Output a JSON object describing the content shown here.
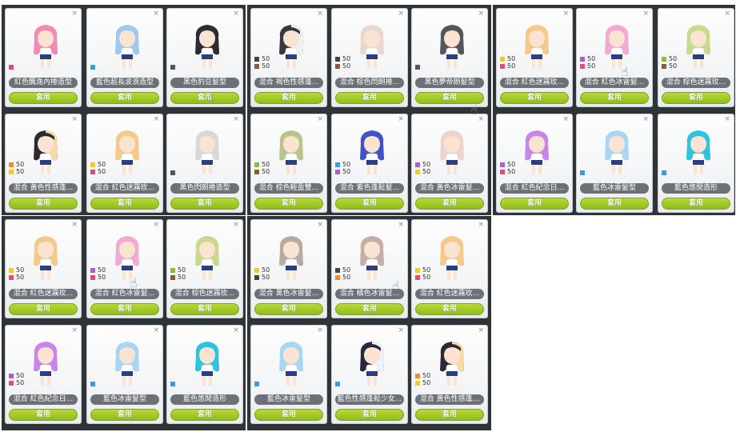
{
  "apply_label": "套用",
  "close_glyph": "×",
  "hand_glyph": "☝",
  "cards": [
    {
      "name": "紅色飄逸內捲造型",
      "hair": "#f28ab8",
      "legend": [
        {
          "color": "#e04b7a"
        }
      ]
    },
    {
      "name": "藍色超長波浪造型",
      "hair": "#9ec8ef",
      "legend": [
        {
          "color": "#3a9be0"
        }
      ]
    },
    {
      "name": "黑色豹豆髮型",
      "hair": "#2e2a36",
      "legend": [
        {
          "color": "#555555"
        }
      ]
    },
    {
      "name": "混合 褐色性感蓬...",
      "hair": "#3a3540",
      "hair2": "#f0f0f0",
      "legend": [
        {
          "color": "#444444",
          "pct": "50"
        },
        {
          "color": "#8b5a3c",
          "pct": "50"
        }
      ]
    },
    {
      "name": "混合 棕色閃朗捲...",
      "hair": "#e9d8cf",
      "legend": [
        {
          "color": "#444444",
          "pct": "50"
        },
        {
          "color": "#8b5a3c",
          "pct": "50"
        }
      ]
    },
    {
      "name": "黑色夢帝朗髮型",
      "hair": "#55555c",
      "legend": [
        {
          "color": "#555555"
        }
      ]
    },
    {
      "name": "混合 紅色迷霧玫...",
      "hair": "#f5c98a",
      "legend": [
        {
          "color": "#f2cc1e",
          "pct": "50"
        },
        {
          "color": "#e04b7a",
          "pct": "50"
        }
      ]
    },
    {
      "name": "混合 紅色冰雷髮...",
      "hair": "#f4a9d4",
      "legend": [
        {
          "color": "#a65fd6",
          "pct": "50"
        },
        {
          "color": "#e04b7a",
          "pct": "50"
        }
      ]
    },
    {
      "name": "混合 棕色迷霧玫...",
      "hair": "#c7d98a",
      "legend": [
        {
          "color": "#8cbf2e",
          "pct": "50"
        },
        {
          "color": "#8b5a3c",
          "pct": "50"
        }
      ]
    },
    {
      "name": "混合 黃色性感蓬...",
      "hair": "#2a2a30",
      "hair2": "#f7d9a8",
      "legend": [
        {
          "color": "#f08a2e",
          "pct": "50"
        },
        {
          "color": "#f2cc1e",
          "pct": "50"
        }
      ]
    },
    {
      "name": "混合 紅色迷霧玫...",
      "hair": "#f5c98a",
      "legend": [
        {
          "color": "#f2cc1e",
          "pct": "50"
        },
        {
          "color": "#e04b7a",
          "pct": "50"
        }
      ]
    },
    {
      "name": "黑色閃朗捲造型",
      "hair": "#d8d8dc",
      "legend": [
        {
          "color": "#555555"
        }
      ]
    },
    {
      "name": "混合 棕色輕盈雙...",
      "hair": "#b9c48a",
      "legend": [
        {
          "color": "#8cbf2e",
          "pct": "50"
        },
        {
          "color": "#8b5a3c",
          "pct": "50"
        }
      ]
    },
    {
      "name": "混合 紫色蓬鬆髮...",
      "hair": "#3f52c8",
      "legend": [
        {
          "color": "#3a9be0",
          "pct": "50"
        },
        {
          "color": "#a65fd6",
          "pct": "50"
        }
      ]
    },
    {
      "name": "混合 黃色冰雷髮...",
      "hair": "#eed3cc",
      "legend": [
        {
          "color": "#a65fd6",
          "pct": "50"
        },
        {
          "color": "#f2cc1e",
          "pct": "50"
        }
      ]
    },
    {
      "name": "混合 紅色紀念日...",
      "hair": "#c886e8",
      "legend": [
        {
          "color": "#a65fd6",
          "pct": "50"
        },
        {
          "color": "#e04b7a",
          "pct": "50"
        }
      ]
    },
    {
      "name": "藍色冰雷髮型",
      "hair": "#a6d6f4",
      "legend": [
        {
          "color": "#3a9be0"
        }
      ]
    },
    {
      "name": "藍色悠閒造形",
      "hair": "#2fc3e0",
      "legend": [
        {
          "color": "#3a9be0"
        }
      ]
    },
    {
      "name": "混合 紅色迷霧玫...",
      "hair": "#f5c98a",
      "legend": [
        {
          "color": "#f2cc1e",
          "pct": "50"
        },
        {
          "color": "#e04b7a",
          "pct": "50"
        }
      ]
    },
    {
      "name": "混合 紅色冰雷髮...",
      "hair": "#f4a9d4",
      "legend": [
        {
          "color": "#a65fd6",
          "pct": "50"
        },
        {
          "color": "#e04b7a",
          "pct": "50"
        }
      ]
    },
    {
      "name": "混合 棕色迷霧玫...",
      "hair": "#c7d98a",
      "legend": [
        {
          "color": "#8cbf2e",
          "pct": "50"
        },
        {
          "color": "#8b5a3c",
          "pct": "50"
        }
      ]
    },
    {
      "name": "混合 黑色冰雷髮...",
      "hair": "#b7aca4",
      "legend": [
        {
          "color": "#f2cc1e",
          "pct": "50"
        },
        {
          "color": "#444444",
          "pct": "50"
        }
      ]
    },
    {
      "name": "混合 橘色冰雷髮...",
      "hair": "#c2b0a8",
      "legend": [
        {
          "color": "#444444",
          "pct": "50"
        },
        {
          "color": "#f08a2e",
          "pct": "50"
        }
      ]
    },
    {
      "name": "混合 紅色迷霧玫...",
      "hair": "#f5c98a",
      "legend": [
        {
          "color": "#f2cc1e",
          "pct": "50"
        },
        {
          "color": "#e04b7a",
          "pct": "50"
        }
      ]
    },
    {
      "name": "混合 紅色紀念日...",
      "hair": "#c886e8",
      "legend": [
        {
          "color": "#a65fd6",
          "pct": "50"
        },
        {
          "color": "#e04b7a",
          "pct": "50"
        }
      ]
    },
    {
      "name": "藍色冰雷髮型",
      "hair": "#a6d6f4",
      "legend": [
        {
          "color": "#3a9be0"
        }
      ]
    },
    {
      "name": "藍色悠閒造形",
      "hair": "#2fc3e0",
      "legend": [
        {
          "color": "#3a9be0"
        }
      ]
    },
    {
      "name": "藍色冰雷髮型",
      "hair": "#a6d6f4",
      "legend": [
        {
          "color": "#3a9be0"
        }
      ]
    },
    {
      "name": "藍色性感蓬鬆少女...",
      "hair": "#28283a",
      "hair2": "#eef3fa",
      "legend": [
        {
          "color": "#3a9be0"
        }
      ]
    },
    {
      "name": "混合 黃色性感蓬...",
      "hair": "#2a2a30",
      "hair2": "#f7d9a8",
      "legend": [
        {
          "color": "#f08a2e",
          "pct": "50"
        },
        {
          "color": "#f2cc1e",
          "pct": "50"
        }
      ]
    }
  ]
}
